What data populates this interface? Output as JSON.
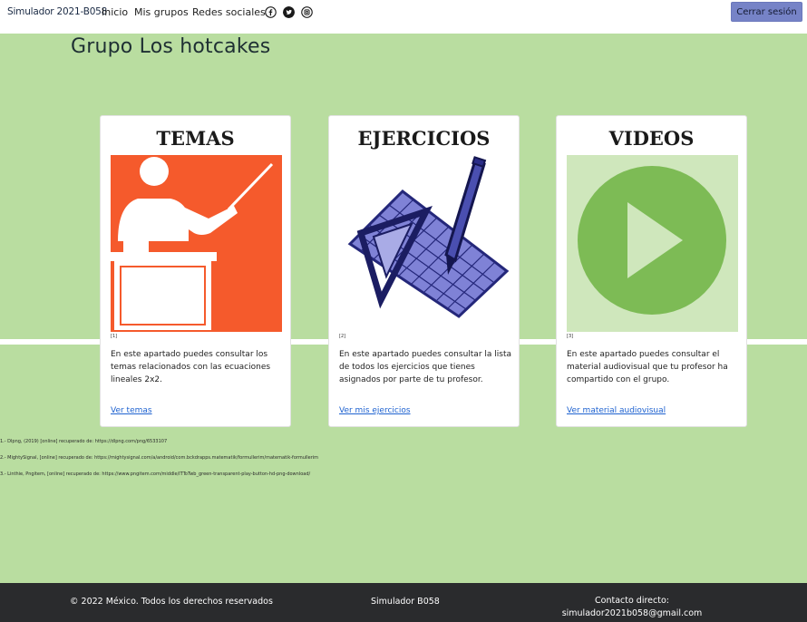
{
  "navbar": {
    "brand": "Simulador 2021-B058",
    "links": [
      "Inicio",
      "Mis grupos",
      "Redes sociales:"
    ],
    "social_icons": [
      "facebook-icon",
      "twitter-icon",
      "instagram-icon"
    ],
    "logout_label": "Cerrar sesión"
  },
  "page": {
    "title": "Grupo Los hotcakes"
  },
  "cards": [
    {
      "title": "TEMAS",
      "image": "teacher-presentation-icon",
      "ref": "[1]",
      "text": "En este apartado puedes consultar los temas relacionados con las ecuaciones lineales 2x2.",
      "link": "Ver temas"
    },
    {
      "title": "EJERCICIOS",
      "image": "math-tools-icon",
      "ref": "[2]",
      "text": "En este apartado puedes consultar la lista de todos los ejercicios que tienes asignados por parte de tu profesor.",
      "link": "Ver mis ejercicios"
    },
    {
      "title": "VIDEOS",
      "image": "play-button-icon",
      "ref": "[3]",
      "text": "En este apartado puedes consultar el material audiovisual que tu profesor ha compartido con el grupo.",
      "link": "Ver material audiovisual"
    }
  ],
  "citations": [
    "1.- Dlpng, (2019) [online] recuperado de: https://dlpng.com/png/6533107",
    "2.- MightySignal, [online] recuperado de: https://mightysignal.com/a/android/com.bckdrapps.matematik/formullerim/matematik-formullerim",
    "3.- Linthie, Pngitem, [online] recuperado de: https://www.pngitem.com/middle/ITToTwb_green-transparent-play-button-hd-png-download/"
  ],
  "footer": {
    "copyright": "© 2022 México. Todos los derechos reservados",
    "site": "Simulador B058",
    "contact_label": "Contacto directo:",
    "contact_email": "simulador2021b058@gmail.com"
  },
  "colors": {
    "background": "#b9dda0",
    "button": "#7683c7",
    "footer": "#2a2b2d",
    "link": "#1e62d0",
    "teacher_orange": "#f55a2c",
    "play_green": "#7dbb55"
  }
}
